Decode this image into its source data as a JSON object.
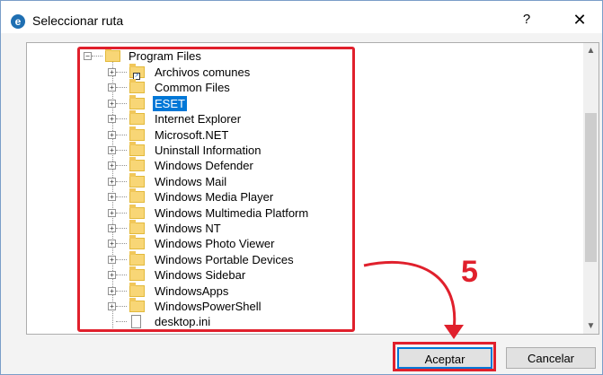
{
  "window": {
    "title": "Seleccionar ruta",
    "app_icon": "e",
    "help_label": "?",
    "close_label": "✕"
  },
  "tree": {
    "root": {
      "label": "Program Files",
      "icon": "folder-open-icon"
    },
    "items": [
      {
        "label": "Archivos comunes",
        "icon": "folder-shortcut-icon"
      },
      {
        "label": "Common Files",
        "icon": "folder-icon"
      },
      {
        "label": "ESET",
        "icon": "folder-icon",
        "selected": true
      },
      {
        "label": "Internet Explorer",
        "icon": "folder-icon"
      },
      {
        "label": "Microsoft.NET",
        "icon": "folder-icon"
      },
      {
        "label": "Uninstall Information",
        "icon": "folder-icon"
      },
      {
        "label": "Windows Defender",
        "icon": "folder-icon"
      },
      {
        "label": "Windows Mail",
        "icon": "folder-icon"
      },
      {
        "label": "Windows Media Player",
        "icon": "folder-icon"
      },
      {
        "label": "Windows Multimedia Platform",
        "icon": "folder-icon"
      },
      {
        "label": "Windows NT",
        "icon": "folder-icon"
      },
      {
        "label": "Windows Photo Viewer",
        "icon": "folder-icon"
      },
      {
        "label": "Windows Portable Devices",
        "icon": "folder-icon"
      },
      {
        "label": "Windows Sidebar",
        "icon": "folder-icon"
      },
      {
        "label": "WindowsApps",
        "icon": "folder-icon"
      },
      {
        "label": "WindowsPowerShell",
        "icon": "folder-icon"
      },
      {
        "label": "desktop.ini",
        "icon": "file-icon"
      }
    ]
  },
  "annotation": {
    "step_number": "5",
    "highlight_color": "#e0202c"
  },
  "buttons": {
    "ok_label": "Aceptar",
    "cancel_label": "Cancelar"
  },
  "colors": {
    "selection": "#0078d7",
    "folder": "#f8d676"
  }
}
